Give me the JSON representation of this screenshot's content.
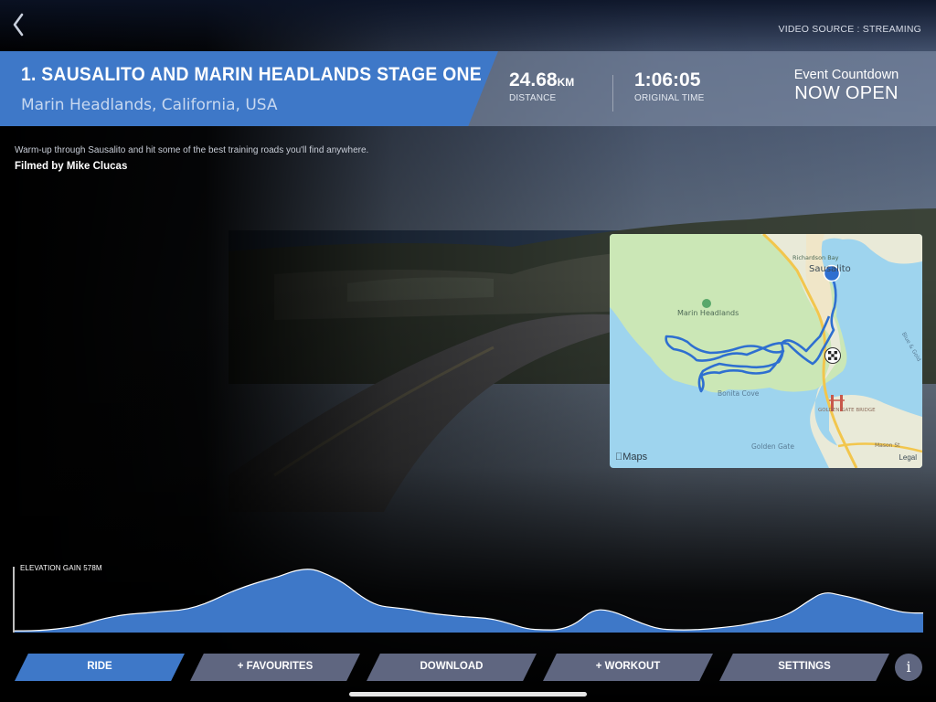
{
  "header": {
    "video_source": "VIDEO SOURCE : STREAMING",
    "title": "1. SAUSALITO AND MARIN HEADLANDS STAGE ONE",
    "location": "Marin Headlands, California, USA"
  },
  "stats": {
    "distance_value": "24.68",
    "distance_unit": "KM",
    "distance_label": "DISTANCE",
    "time_value": "1:06:05",
    "time_label": "ORIGINAL TIME"
  },
  "countdown": {
    "label": "Event Countdown",
    "status": "NOW OPEN"
  },
  "description": "Warm-up through Sausalito and hit some of the best training roads you'll find anywhere.",
  "credit": "Filmed by Mike Clucas",
  "map": {
    "labels": {
      "richardson_bay": "Richardson Bay",
      "sausalito": "Sausalito",
      "marin_headlands": "Marin Headlands",
      "bonita_cove": "Bonita Cove",
      "golden_gate_bridge": "GOLDEN GATE BRIDGE",
      "golden_gate": "Golden Gate",
      "mason_st": "Mason St",
      "blue_gold": "Blue & Gold"
    },
    "provider": "Maps",
    "legal": "Legal",
    "route_color": "#2e6fd0"
  },
  "elevation": {
    "label": "ELEVATION GAIN 578M",
    "profile": [
      2,
      2,
      3,
      5,
      8,
      14,
      18,
      21,
      22,
      24,
      25,
      29,
      36,
      45,
      52,
      58,
      63,
      70,
      72,
      65,
      55,
      40,
      30,
      28,
      26,
      22,
      20,
      18,
      17,
      15,
      10,
      4,
      3,
      3,
      10,
      26,
      25,
      18,
      10,
      4,
      3,
      3,
      4,
      6,
      8,
      12,
      15,
      22,
      35,
      46,
      42,
      38,
      32,
      26,
      22,
      22
    ]
  },
  "nav": {
    "ride": "RIDE",
    "favourites": "+ FAVOURITES",
    "download": "DOWNLOAD",
    "workout": "+ WORKOUT",
    "settings": "SETTINGS",
    "info": "i"
  },
  "colors": {
    "accent": "#3e78c8",
    "nav_inactive": "#5f6680",
    "header_bg": "#8796af"
  }
}
